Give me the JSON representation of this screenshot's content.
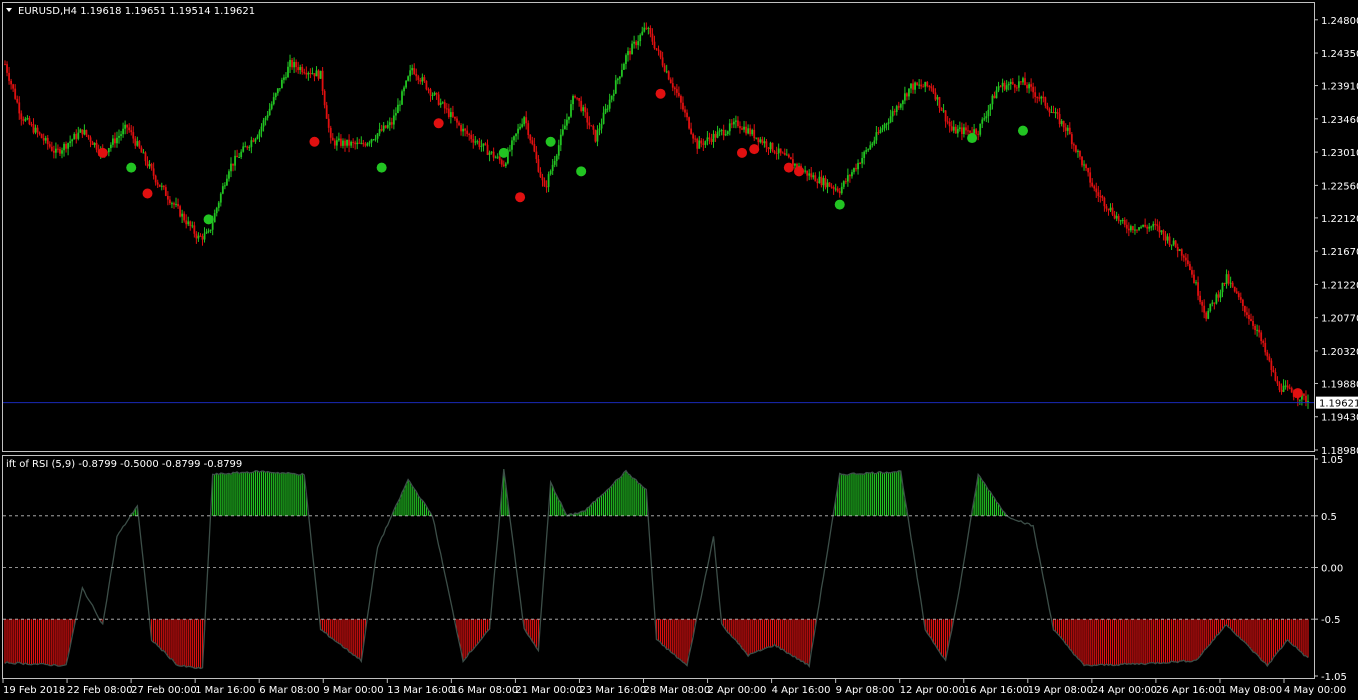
{
  "main_title": "EURUSD,H4  1.19618 1.19651 1.19514 1.19621",
  "sub_title": "ift of RSI (5,9) -0.8799 -0.5000 -0.8799 -0.8799",
  "price_axis": [
    "1.24800",
    "1.24350",
    "1.23910",
    "1.23460",
    "1.23010",
    "1.22560",
    "1.22120",
    "1.21670",
    "1.21220",
    "1.20770",
    "1.20320",
    "1.19880",
    "1.19430",
    "1.18980"
  ],
  "current_price": "1.19621",
  "osc_axis": [
    "1.05",
    "0.5",
    "0.00",
    "-0.5",
    "-1.05"
  ],
  "time_axis": [
    "19 Feb 2018",
    "22 Feb 08:00",
    "27 Feb 00:00",
    "1 Mar 16:00",
    "6 Mar 08:00",
    "9 Mar 00:00",
    "13 Mar 16:00",
    "16 Mar 08:00",
    "21 Mar 00:00",
    "23 Mar 16:00",
    "28 Mar 08:00",
    "2 Apr 00:00",
    "4 Apr 16:00",
    "9 Apr 08:00",
    "12 Apr 00:00",
    "16 Apr 16:00",
    "19 Apr 08:00",
    "24 Apr 00:00",
    "26 Apr 16:00",
    "1 May 08:00",
    "4 May 00:00"
  ],
  "colors": {
    "background": "#000000",
    "bull": "#22c422",
    "bear": "#e01010",
    "grid": "#c0c0c0",
    "osc_line": "#3c4e48",
    "price_line": "#1a2ab8"
  },
  "chart_data": [
    {
      "type": "candlestick",
      "title": "EURUSD,H4",
      "ylim": [
        1.1898,
        1.25
      ],
      "current_price": 1.19621,
      "ohlc_last": {
        "open": 1.19618,
        "high": 1.19651,
        "low": 1.19514,
        "close": 1.19621
      },
      "price_path": [
        {
          "t": 0,
          "p": 1.242
        },
        {
          "t": 8,
          "p": 1.235
        },
        {
          "t": 25,
          "p": 1.23
        },
        {
          "t": 38,
          "p": 1.233
        },
        {
          "t": 48,
          "p": 1.23
        },
        {
          "t": 60,
          "p": 1.2335
        },
        {
          "t": 75,
          "p": 1.226
        },
        {
          "t": 95,
          "p": 1.2185
        },
        {
          "t": 100,
          "p": 1.219
        },
        {
          "t": 110,
          "p": 1.228
        },
        {
          "t": 125,
          "p": 1.233
        },
        {
          "t": 140,
          "p": 1.242
        },
        {
          "t": 155,
          "p": 1.2405
        },
        {
          "t": 160,
          "p": 1.2315
        },
        {
          "t": 175,
          "p": 1.231
        },
        {
          "t": 190,
          "p": 1.234
        },
        {
          "t": 200,
          "p": 1.2415
        },
        {
          "t": 210,
          "p": 1.238
        },
        {
          "t": 225,
          "p": 1.233
        },
        {
          "t": 245,
          "p": 1.2285
        },
        {
          "t": 255,
          "p": 1.235
        },
        {
          "t": 265,
          "p": 1.225
        },
        {
          "t": 280,
          "p": 1.238
        },
        {
          "t": 290,
          "p": 1.232
        },
        {
          "t": 305,
          "p": 1.243
        },
        {
          "t": 315,
          "p": 1.247
        },
        {
          "t": 330,
          "p": 1.238
        },
        {
          "t": 340,
          "p": 1.231
        },
        {
          "t": 360,
          "p": 1.234
        },
        {
          "t": 375,
          "p": 1.231
        },
        {
          "t": 395,
          "p": 1.227
        },
        {
          "t": 410,
          "p": 1.225
        },
        {
          "t": 425,
          "p": 1.231
        },
        {
          "t": 445,
          "p": 1.239
        },
        {
          "t": 455,
          "p": 1.239
        },
        {
          "t": 465,
          "p": 1.233
        },
        {
          "t": 478,
          "p": 1.233
        },
        {
          "t": 488,
          "p": 1.239
        },
        {
          "t": 500,
          "p": 1.2395
        },
        {
          "t": 510,
          "p": 1.237
        },
        {
          "t": 522,
          "p": 1.233
        },
        {
          "t": 535,
          "p": 1.225
        },
        {
          "t": 550,
          "p": 1.22
        },
        {
          "t": 565,
          "p": 1.22
        },
        {
          "t": 580,
          "p": 1.216
        },
        {
          "t": 590,
          "p": 1.208
        },
        {
          "t": 600,
          "p": 1.213
        },
        {
          "t": 615,
          "p": 1.206
        },
        {
          "t": 625,
          "p": 1.1985
        },
        {
          "t": 640,
          "p": 1.1965
        }
      ],
      "buy_signals": [
        {
          "t": 62,
          "p": 1.228
        },
        {
          "t": 100,
          "p": 1.221
        },
        {
          "t": 185,
          "p": 1.228
        },
        {
          "t": 245,
          "p": 1.23
        },
        {
          "t": 268,
          "p": 1.2315
        },
        {
          "t": 283,
          "p": 1.2275
        },
        {
          "t": 410,
          "p": 1.223
        },
        {
          "t": 475,
          "p": 1.232
        },
        {
          "t": 500,
          "p": 1.233
        }
      ],
      "sell_signals": [
        {
          "t": 48,
          "p": 1.23
        },
        {
          "t": 70,
          "p": 1.2245
        },
        {
          "t": 152,
          "p": 1.2315
        },
        {
          "t": 213,
          "p": 1.234
        },
        {
          "t": 253,
          "p": 1.224
        },
        {
          "t": 322,
          "p": 1.238
        },
        {
          "t": 362,
          "p": 1.23
        },
        {
          "t": 368,
          "p": 1.2305
        },
        {
          "t": 385,
          "p": 1.228
        },
        {
          "t": 390,
          "p": 1.2275
        },
        {
          "t": 635,
          "p": 1.1975
        }
      ]
    },
    {
      "type": "area",
      "title": "ift of RSI (5,9)",
      "ylim": [
        -1.05,
        1.05
      ],
      "levels": [
        0.5,
        0.0,
        -0.5
      ],
      "values_at_last": [
        -0.8799,
        -0.5,
        -0.8799,
        -0.8799
      ],
      "series": [
        {
          "t": 0,
          "v": -0.92
        },
        {
          "t": 30,
          "v": -0.95
        },
        {
          "t": 38,
          "v": -0.2
        },
        {
          "t": 48,
          "v": -0.55
        },
        {
          "t": 55,
          "v": 0.3
        },
        {
          "t": 65,
          "v": 0.6
        },
        {
          "t": 72,
          "v": -0.7
        },
        {
          "t": 85,
          "v": -0.95
        },
        {
          "t": 97,
          "v": -0.98
        },
        {
          "t": 102,
          "v": 0.9
        },
        {
          "t": 125,
          "v": 0.93
        },
        {
          "t": 147,
          "v": 0.9
        },
        {
          "t": 155,
          "v": -0.6
        },
        {
          "t": 175,
          "v": -0.9
        },
        {
          "t": 183,
          "v": 0.2
        },
        {
          "t": 198,
          "v": 0.85
        },
        {
          "t": 210,
          "v": 0.5
        },
        {
          "t": 225,
          "v": -0.9
        },
        {
          "t": 238,
          "v": -0.6
        },
        {
          "t": 245,
          "v": 0.95
        },
        {
          "t": 255,
          "v": -0.6
        },
        {
          "t": 262,
          "v": -0.8
        },
        {
          "t": 268,
          "v": 0.82
        },
        {
          "t": 276,
          "v": 0.5
        },
        {
          "t": 285,
          "v": 0.55
        },
        {
          "t": 305,
          "v": 0.93
        },
        {
          "t": 315,
          "v": 0.75
        },
        {
          "t": 320,
          "v": -0.7
        },
        {
          "t": 335,
          "v": -0.95
        },
        {
          "t": 348,
          "v": 0.3
        },
        {
          "t": 352,
          "v": -0.55
        },
        {
          "t": 365,
          "v": -0.85
        },
        {
          "t": 378,
          "v": -0.75
        },
        {
          "t": 395,
          "v": -0.95
        },
        {
          "t": 410,
          "v": 0.9
        },
        {
          "t": 440,
          "v": 0.93
        },
        {
          "t": 452,
          "v": -0.6
        },
        {
          "t": 462,
          "v": -0.9
        },
        {
          "t": 468,
          "v": -0.3
        },
        {
          "t": 478,
          "v": 0.9
        },
        {
          "t": 492,
          "v": 0.5
        },
        {
          "t": 505,
          "v": 0.4
        },
        {
          "t": 515,
          "v": -0.6
        },
        {
          "t": 530,
          "v": -0.95
        },
        {
          "t": 560,
          "v": -0.93
        },
        {
          "t": 585,
          "v": -0.9
        },
        {
          "t": 600,
          "v": -0.55
        },
        {
          "t": 620,
          "v": -0.95
        },
        {
          "t": 630,
          "v": -0.7
        },
        {
          "t": 640,
          "v": -0.88
        }
      ]
    }
  ]
}
